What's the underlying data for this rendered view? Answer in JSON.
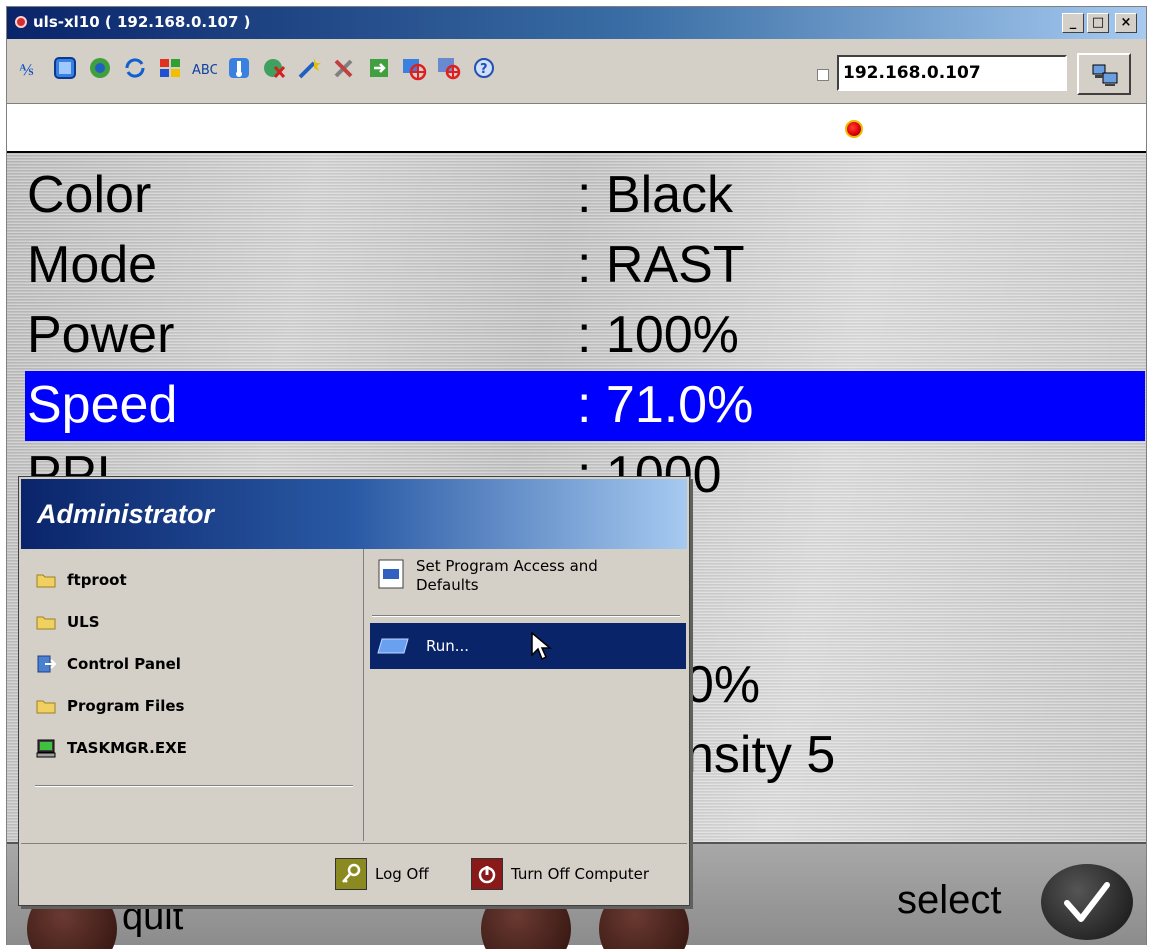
{
  "window": {
    "title": "uls-xl10 ( 192.168.0.107 )",
    "controls": {
      "minimize": "_",
      "maximize": "□",
      "close": "×"
    }
  },
  "toolbar": {
    "icons": [
      "change-ip-icon",
      "window-icon",
      "globe-gear-icon",
      "refresh-icon",
      "windows-flag-icon",
      "text-abc-icon",
      "thermometer-icon",
      "globe-x-icon",
      "wand-icon",
      "tools-icon",
      "transfer-icon",
      "target-icon",
      "target-window-icon",
      "help-icon"
    ],
    "ip_address": "192.168.0.107"
  },
  "colors": {
    "selected_row": "#0000ff",
    "title_gradient_start": "#0a246a",
    "title_gradient_end": "#a6caf0",
    "status_led": "#e00000"
  },
  "settings": {
    "rows": [
      {
        "label": "Color",
        "value": ": Black"
      },
      {
        "label": "Mode",
        "value": ": RAST"
      },
      {
        "label": "Power",
        "value": ": 100%"
      },
      {
        "label": "Speed",
        "value": ": 71.0%"
      },
      {
        "label": "PPI",
        "value": ": 1000"
      }
    ],
    "partial_values": [
      "0%",
      "nsity 5"
    ]
  },
  "bottom_bar": {
    "quit_label": "quit",
    "select_label": "select"
  },
  "start_menu": {
    "user": "Administrator",
    "left_items": [
      {
        "label": "ftproot",
        "icon": "folder-icon"
      },
      {
        "label": "ULS",
        "icon": "folder-icon"
      },
      {
        "label": "Control Panel",
        "icon": "control-panel-icon"
      },
      {
        "label": "Program Files",
        "icon": "folder-icon"
      },
      {
        "label": "TASKMGR.EXE",
        "icon": "computer-icon"
      }
    ],
    "right_items": {
      "program_access": "Set Program Access and Defaults",
      "program_access_line1": "Set Program Access and",
      "program_access_line2": "Defaults",
      "run": "Run..."
    },
    "footer": {
      "log_off": "Log Off",
      "turn_off": "Turn Off Computer"
    }
  }
}
